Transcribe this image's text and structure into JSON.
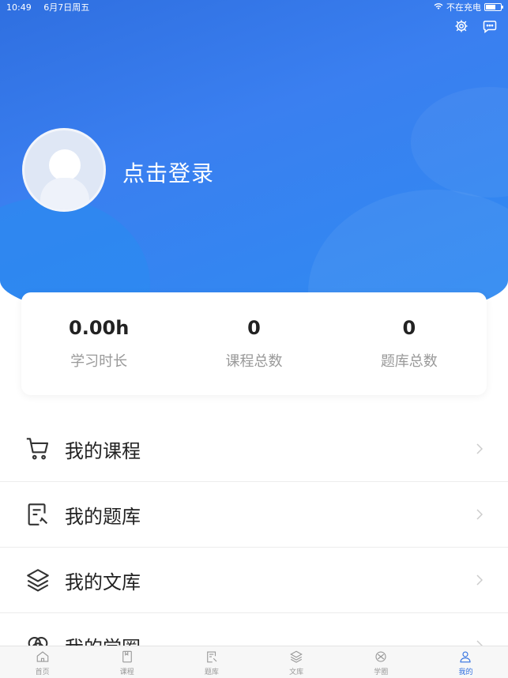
{
  "status_bar": {
    "time": "10:49",
    "date": "6月7日周五",
    "charging": "不在充电"
  },
  "header": {
    "login_text": "点击登录"
  },
  "stats": [
    {
      "value": "0.00h",
      "label": "学习时长"
    },
    {
      "value": "0",
      "label": "课程总数"
    },
    {
      "value": "0",
      "label": "题库总数"
    }
  ],
  "menu": [
    {
      "label": "我的课程",
      "icon": "cart-icon"
    },
    {
      "label": "我的题库",
      "icon": "question-bank-icon"
    },
    {
      "label": "我的文库",
      "icon": "layers-icon"
    },
    {
      "label": "我的学圈",
      "icon": "circle-icon"
    }
  ],
  "tabs": [
    {
      "label": "首页",
      "icon": "home-icon"
    },
    {
      "label": "课程",
      "icon": "book-icon"
    },
    {
      "label": "题库",
      "icon": "question-bank-icon"
    },
    {
      "label": "文库",
      "icon": "layers-icon"
    },
    {
      "label": "学圈",
      "icon": "circle-icon"
    },
    {
      "label": "我的",
      "icon": "user-icon",
      "active": true
    }
  ],
  "colors": {
    "primary": "#2f6fe0",
    "text": "#222222",
    "muted": "#999999"
  }
}
